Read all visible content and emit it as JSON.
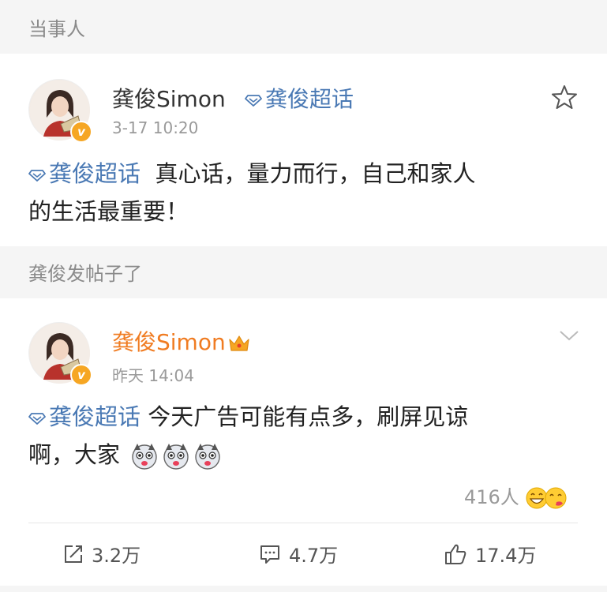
{
  "section1": {
    "header": "当事人"
  },
  "post1": {
    "author": "龚俊Simon",
    "super_topic": "龚俊超话",
    "time": "3-17 10:20",
    "topic": "龚俊超话",
    "text_line1": "真心话，量力而行，自己和家人",
    "text_line2": "的生活最重要！"
  },
  "section2": {
    "header": "龚俊发帖子了"
  },
  "post2": {
    "author": "龚俊Simon",
    "time": "昨天 14:04",
    "topic": "龚俊超话",
    "text_line1": "今天广告可能有点多，刷屏见谅",
    "text_line2": "啊，大家",
    "reaction_count": "416人"
  },
  "actions": {
    "share": "3.2万",
    "comment": "4.7万",
    "like": "17.4万"
  },
  "colors": {
    "topic_blue": "#4a79b4",
    "vip_orange": "#f07c22",
    "badge_orange": "#f6a623"
  }
}
